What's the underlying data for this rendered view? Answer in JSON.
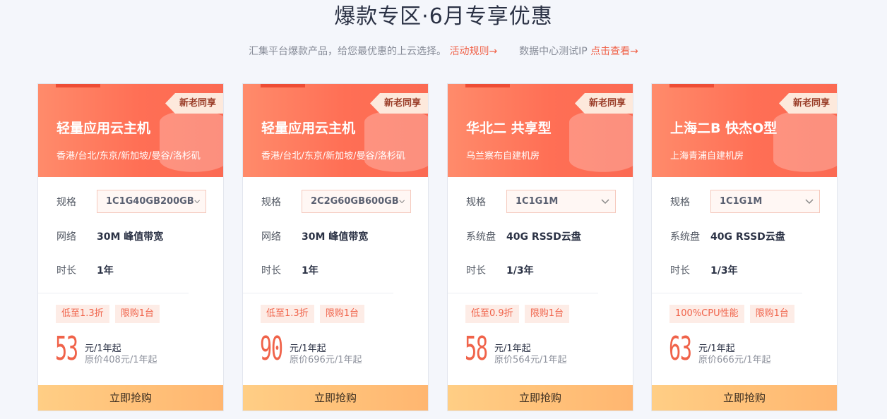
{
  "header": {
    "title": "爆款专区·6月专享优惠",
    "subtitle_text": "汇集平台爆款产品，给您最优惠的上云选择。",
    "rules_link": "活动规则→",
    "test_ip_text": "数据中心测试IP",
    "view_link": "点击查看→"
  },
  "colors": {
    "accent": "#f0634a",
    "head_gradient": "#ff7a5e",
    "buy_button": "#ffc27a"
  },
  "cards": [
    {
      "badge": "新老同享",
      "title": "轻量应用云主机",
      "subtitle": "香港/台北/东京/新加坡/曼谷/洛杉矶",
      "spec_label": "规格",
      "spec_value": "1C1G40GB200GB",
      "row2_label": "网络",
      "row2_value": "30M 峰值带宽",
      "row3_label": "时长",
      "row3_value": "1年",
      "tags": [
        "低至1.3折",
        "限购1台"
      ],
      "price": "53",
      "price_unit": "元/1年起",
      "original_price": "原价408元/1年起",
      "buy_label": "立即抢购"
    },
    {
      "badge": "新老同享",
      "title": "轻量应用云主机",
      "subtitle": "香港/台北/东京/新加坡/曼谷/洛杉矶",
      "spec_label": "规格",
      "spec_value": "2C2G60GB600GB",
      "row2_label": "网络",
      "row2_value": "30M 峰值带宽",
      "row3_label": "时长",
      "row3_value": "1年",
      "tags": [
        "低至1.3折",
        "限购1台"
      ],
      "price": "90",
      "price_unit": "元/1年起",
      "original_price": "原价696元/1年起",
      "buy_label": "立即抢购"
    },
    {
      "badge": "新老同享",
      "title": "华北二 共享型",
      "subtitle": "乌兰察布自建机房",
      "spec_label": "规格",
      "spec_value": "1C1G1M",
      "row2_label": "系统盘",
      "row2_value": "40G RSSD云盘",
      "row3_label": "时长",
      "row3_value": "1/3年",
      "tags": [
        "低至0.9折",
        "限购1台"
      ],
      "price": "58",
      "price_unit": "元/1年起",
      "original_price": "原价564元/1年起",
      "buy_label": "立即抢购"
    },
    {
      "badge": "新老同享",
      "title": "上海二B 快杰O型",
      "subtitle": "上海青浦自建机房",
      "spec_label": "规格",
      "spec_value": "1C1G1M",
      "row2_label": "系统盘",
      "row2_value": "40G RSSD云盘",
      "row3_label": "时长",
      "row3_value": "1/3年",
      "tags": [
        "100%CPU性能",
        "限购1台"
      ],
      "price": "63",
      "price_unit": "元/1年起",
      "original_price": "原价666元/1年起",
      "buy_label": "立即抢购"
    }
  ]
}
